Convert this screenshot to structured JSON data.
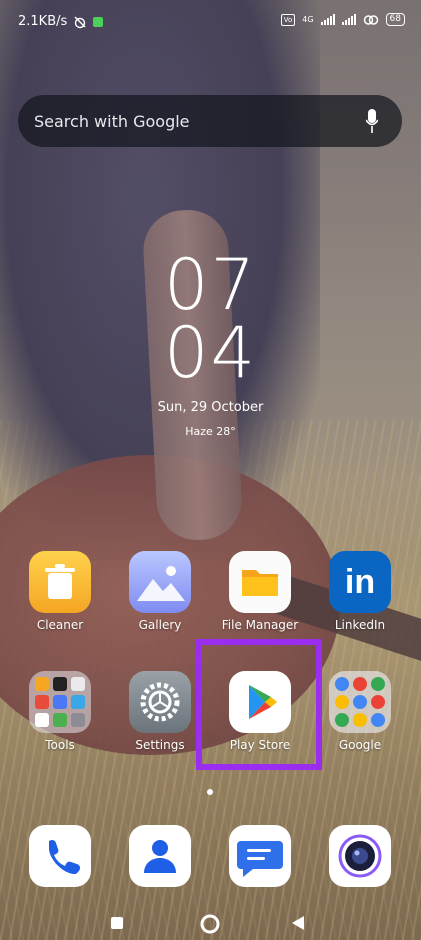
{
  "status_bar": {
    "speed": "2.1KB/s",
    "network": "4G",
    "battery": "68"
  },
  "search": {
    "placeholder": "Search with Google"
  },
  "clock": {
    "hours": "07",
    "minutes": "04"
  },
  "date": "Sun, 29 October",
  "weather": "Haze 28°",
  "apps": [
    {
      "label": "Cleaner",
      "icon": "trash-icon"
    },
    {
      "label": "Gallery",
      "icon": "gallery-icon"
    },
    {
      "label": "File Manager",
      "icon": "folder-icon"
    },
    {
      "label": "LinkedIn",
      "icon": "linkedin-icon",
      "glyph": "in"
    },
    {
      "label": "Tools",
      "icon": "folder-tools-icon"
    },
    {
      "label": "Settings",
      "icon": "gear-icon"
    },
    {
      "label": "Play Store",
      "icon": "play-store-icon"
    },
    {
      "label": "Google",
      "icon": "folder-google-icon"
    }
  ],
  "dock": [
    {
      "icon": "phone-icon"
    },
    {
      "icon": "contacts-icon"
    },
    {
      "icon": "messages-icon"
    },
    {
      "icon": "camera-icon"
    }
  ],
  "nav": [
    {
      "icon": "recents-square-icon"
    },
    {
      "icon": "home-circle-icon"
    },
    {
      "icon": "back-triangle-icon"
    }
  ],
  "colors": {
    "highlight": "#9b2df0",
    "linkedin": "#0a66c2",
    "search_bg": "#14161e"
  }
}
